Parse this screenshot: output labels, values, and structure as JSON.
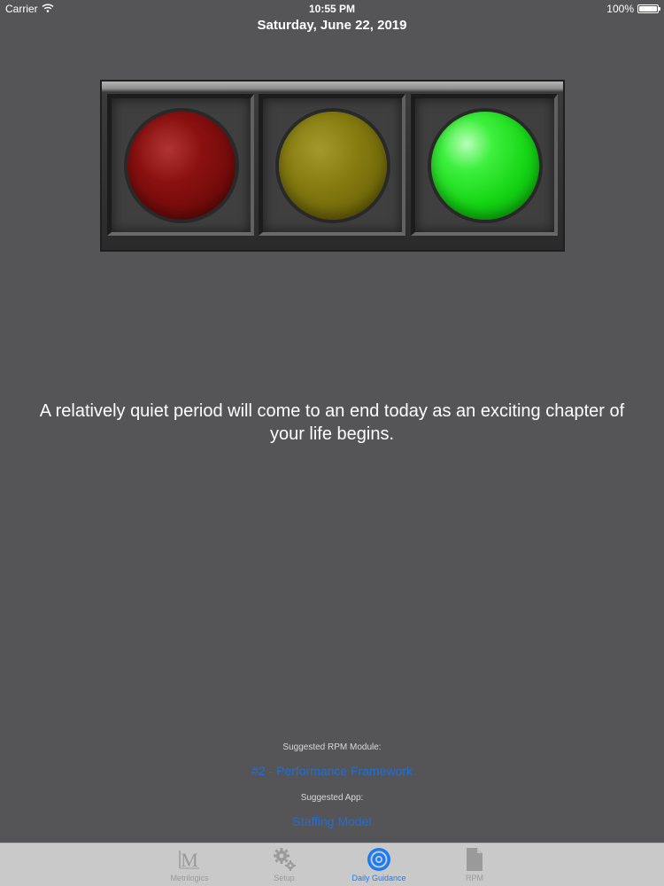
{
  "status_bar": {
    "carrier": "Carrier",
    "time": "10:55 PM",
    "battery": "100%"
  },
  "date": "Saturday, June 22, 2019",
  "traffic_light": {
    "active": "green",
    "lamps": [
      "red",
      "yellow",
      "green"
    ],
    "colors": {
      "red": "#8a1010",
      "yellow": "#857b10",
      "green": "#14d414"
    }
  },
  "message": "A relatively quiet period will come to an end today as an exciting chapter of your life begins.",
  "suggestions": {
    "module_label": "Suggested RPM Module:",
    "module_link": "#2 - Performance Framework",
    "app_label": "Suggested App:",
    "app_link": "Staffing Model"
  },
  "tab_bar": {
    "active_color": "#1a7cf5",
    "inactive_color": "#9a9a9a",
    "tabs": [
      {
        "label": "Metrilogics",
        "icon": "metrilogics-logo-icon"
      },
      {
        "label": "Setup",
        "icon": "gears-icon"
      },
      {
        "label": "Daily Guidance",
        "icon": "target-icon",
        "active": true
      },
      {
        "label": "RPM",
        "icon": "document-icon"
      }
    ]
  }
}
